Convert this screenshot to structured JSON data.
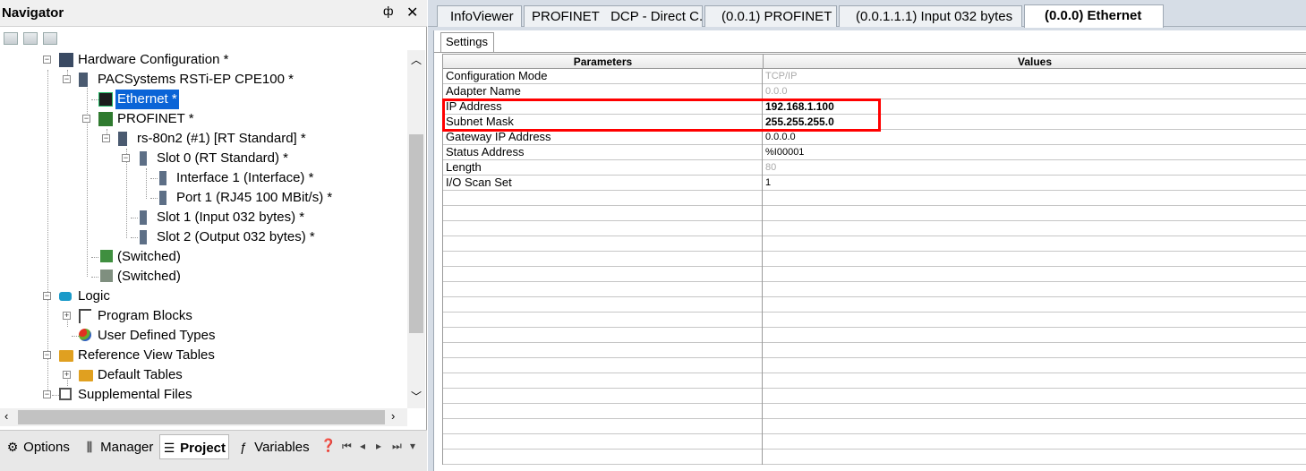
{
  "navigator": {
    "title": "Navigator",
    "pin_glyph": "ф",
    "close_glyph": "✕"
  },
  "tree": [
    {
      "label": "Hardware Configuration *",
      "icon": "hardware-config-icon",
      "color": "#3a4a63"
    },
    {
      "label": "PACSystems RSTi-EP CPE100 *",
      "icon": "cpu-module-icon",
      "color": "#4a5a70"
    },
    {
      "label": "Ethernet *",
      "icon": "ethernet-icon",
      "color": "#1d1d1d",
      "selected": true
    },
    {
      "label": "PROFINET *",
      "icon": "profinet-icon",
      "color": "#2f7a2f"
    },
    {
      "label": "rs-80n2 (#1) [RT Standard] *",
      "icon": "device-icon",
      "color": "#4a5a70"
    },
    {
      "label": "Slot   0 (RT Standard) *",
      "icon": "slot-icon",
      "color": "#5d6f86"
    },
    {
      "label": "Interface   1 (Interface) *",
      "icon": "slot-icon",
      "color": "#5d6f86"
    },
    {
      "label": "Port   1 (RJ45 100 MBit/s) *",
      "icon": "slot-icon",
      "color": "#5d6f86"
    },
    {
      "label": "Slot   1 (Input 032 bytes) *",
      "icon": "slot-icon",
      "color": "#5d6f86"
    },
    {
      "label": "Slot   2 (Output 032 bytes) *",
      "icon": "slot-icon",
      "color": "#5d6f86"
    },
    {
      "label": "(Switched)",
      "icon": "switched-icon",
      "color": "#3f8f3f"
    },
    {
      "label": "(Switched)",
      "icon": "switched-icon",
      "color": "#7f8f7f"
    },
    {
      "label": "Logic",
      "icon": "logic-icon",
      "color": "#1a9ac9"
    },
    {
      "label": "Program Blocks",
      "icon": "program-blocks-icon",
      "color": "#444444"
    },
    {
      "label": "User Defined Types",
      "icon": "user-defined-types-icon",
      "color": "#c04020"
    },
    {
      "label": "Reference View Tables",
      "icon": "folder-icon",
      "color": "#e0a020"
    },
    {
      "label": "Default Tables",
      "icon": "folder-icon",
      "color": "#e0a020"
    },
    {
      "label": "Supplemental Files",
      "icon": "files-icon",
      "color": "#555555"
    }
  ],
  "bottom_tabs": [
    {
      "label": "Options",
      "icon": "gear-icon",
      "glyph": "⚙"
    },
    {
      "label": "Manager",
      "icon": "manager-icon",
      "glyph": "⫼"
    },
    {
      "label": "Project",
      "icon": "project-icon",
      "glyph": "☰",
      "active": true
    },
    {
      "label": "Variables",
      "icon": "variables-icon",
      "glyph": "ƒ"
    }
  ],
  "doc_tabs": [
    {
      "label": "InfoViewer"
    },
    {
      "label": "PROFINET   DCP - Direct C..."
    },
    {
      "label": "(0.0.1) PROFINET"
    },
    {
      "label": "(0.0.1.1.1) Input 032 bytes"
    },
    {
      "label": "(0.0.0) Ethernet",
      "active": true
    }
  ],
  "settings_tab": "Settings",
  "grid": {
    "headers": {
      "parameters": "Parameters",
      "values": "Values"
    },
    "rows": [
      {
        "param": "Configuration Mode",
        "value": "TCP/IP",
        "style": "grey"
      },
      {
        "param": "Adapter Name",
        "value": "0.0.0",
        "style": "grey"
      },
      {
        "param": "IP Address",
        "value": "192.168.1.100",
        "style": "bold"
      },
      {
        "param": "Subnet Mask",
        "value": "255.255.255.0",
        "style": "bold"
      },
      {
        "param": "Gateway IP Address",
        "value": "0.0.0.0",
        "style": "normal"
      },
      {
        "param": "Status Address",
        "value": "%I00001",
        "style": "normal"
      },
      {
        "param": "Length",
        "value": "80",
        "style": "grey"
      },
      {
        "param": "I/O Scan Set",
        "value": "1",
        "style": "normal"
      }
    ],
    "empty_rows": 18
  },
  "colors": {
    "selection": "#0a64d7",
    "highlight_box": "#ff0000"
  }
}
